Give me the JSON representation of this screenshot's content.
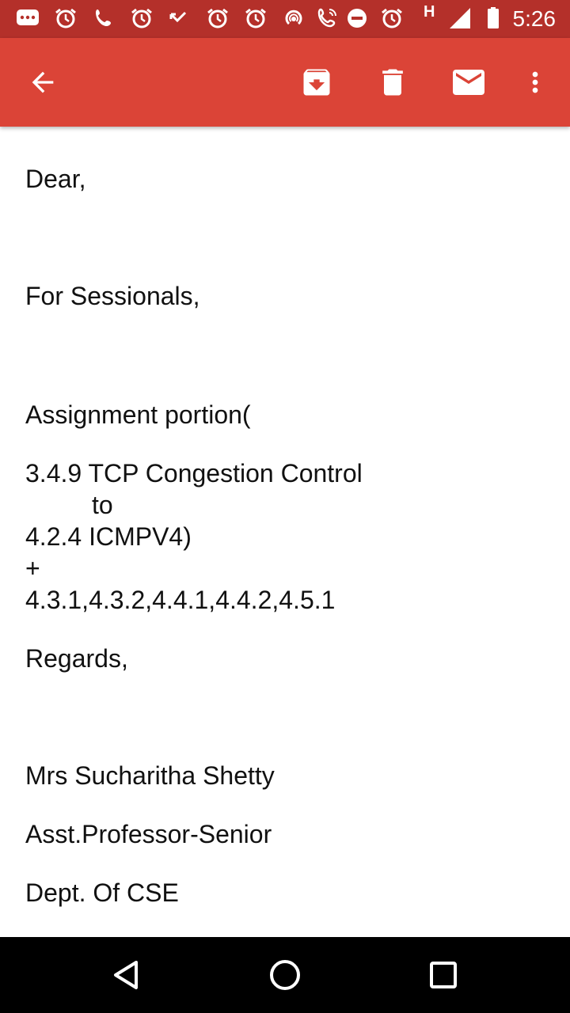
{
  "status_bar": {
    "time": "5:26",
    "network_label": "H",
    "icons": [
      "message-icon",
      "alarm-icon",
      "phone-icon",
      "alarm-icon",
      "missed-call-icon",
      "alarm-icon",
      "alarm-icon",
      "hotspot-icon",
      "wifi-call-icon",
      "dnd-icon",
      "alarm-icon",
      "signal-icon",
      "battery-icon"
    ]
  },
  "app_bar": {
    "back": "back-arrow-icon",
    "archive": "archive-icon",
    "delete": "delete-icon",
    "mark_unread": "mail-icon",
    "more": "more-vert-icon",
    "color": "#db4437"
  },
  "email": {
    "greeting": "Dear,",
    "intro": "For Sessionals,",
    "assignment_heading": "Assignment portion(",
    "range_start": "3.4.9 TCP Congestion Control",
    "range_to": "to",
    "range_end": "4.2.4 ICMPV4)",
    "plus": "+",
    "extra_sections": "4.3.1,4.3.2,4.4.1,4.4.2,4.5.1",
    "closing": "Regards,",
    "sender_name": "Mrs Sucharitha Shetty",
    "sender_title": "Asst.Professor-Senior",
    "sender_dept": "Dept. Of CSE"
  },
  "nav_bar": {
    "back": "nav-back-icon",
    "home": "nav-home-icon",
    "recents": "nav-recents-icon"
  }
}
